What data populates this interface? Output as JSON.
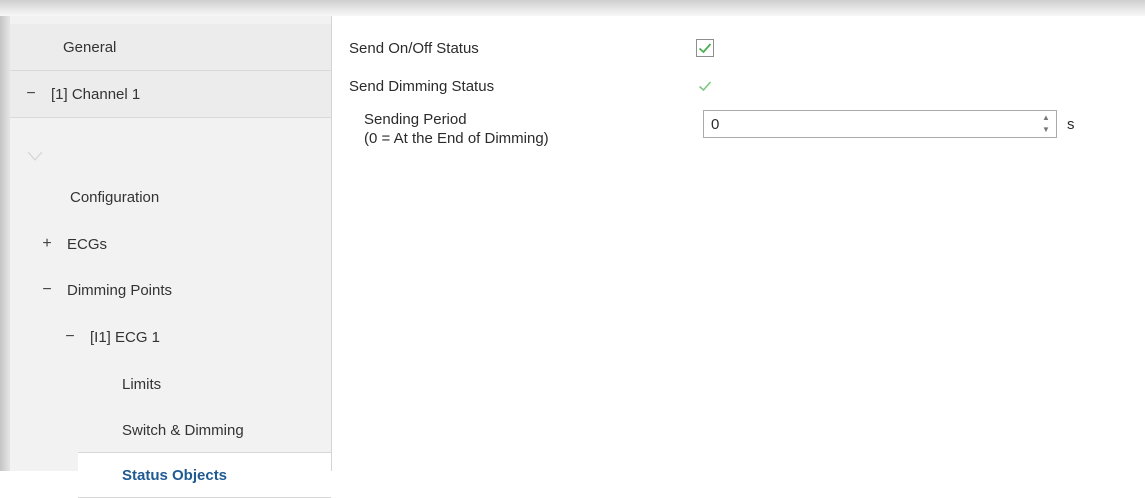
{
  "sidebar": {
    "items": [
      {
        "label": "General"
      },
      {
        "label": "[1] Channel 1",
        "toggle": "−"
      },
      {
        "label": "Configuration"
      },
      {
        "label": "ECGs",
        "toggle": "+"
      },
      {
        "label": "Dimming Points",
        "toggle": "−"
      },
      {
        "label": "[I1] ECG 1",
        "toggle": "−"
      },
      {
        "label": "Limits"
      },
      {
        "label": "Switch & Dimming"
      },
      {
        "label": "Status Objects",
        "active": true
      }
    ]
  },
  "main": {
    "send_on_off": {
      "label": "Send On/Off Status",
      "checked": true
    },
    "send_dimming": {
      "label": "Send Dimming Status",
      "checked": true
    },
    "sending_period": {
      "label_line1": "Sending Period",
      "label_line2": "(0 = At the End of Dimming)",
      "value": "0",
      "unit": "s"
    }
  },
  "colors": {
    "accent_text": "#1f5b92",
    "check_green": "#4caf50",
    "sidebar_bg": "#f2f2f2"
  },
  "icons": {
    "check": "check-icon",
    "spin_up": "spin-up-icon",
    "spin_down": "spin-down-icon"
  }
}
